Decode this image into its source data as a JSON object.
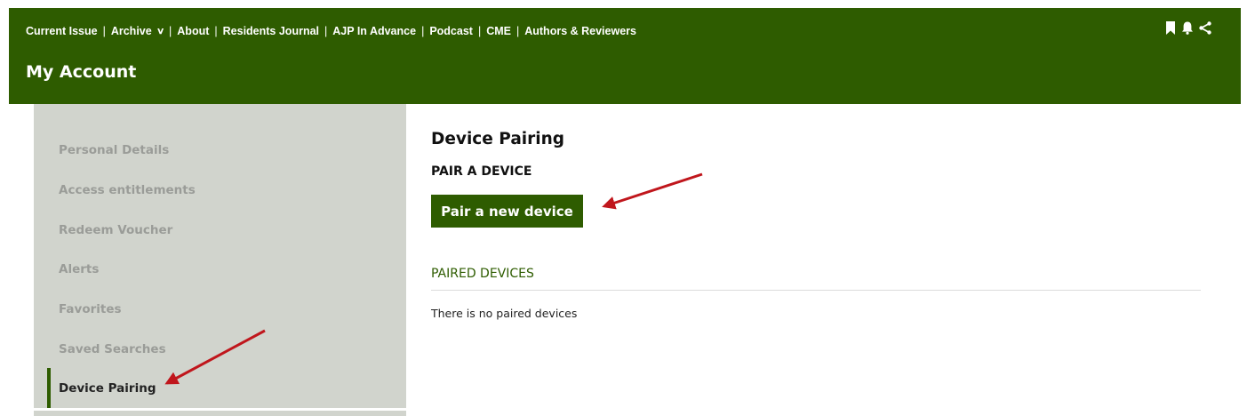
{
  "topnav": {
    "items": [
      "Current Issue",
      "Archive",
      "About",
      "Residents Journal",
      "AJP In Advance",
      "Podcast",
      "CME",
      "Authors & Reviewers"
    ],
    "separator": "|",
    "archive_chevron": "∨"
  },
  "header": {
    "title": "My Account"
  },
  "sidebar": {
    "items": [
      {
        "label": "Personal Details"
      },
      {
        "label": "Access entitlements"
      },
      {
        "label": "Redeem Voucher"
      },
      {
        "label": "Alerts"
      },
      {
        "label": "Favorites"
      },
      {
        "label": "Saved Searches"
      },
      {
        "label": "Device Pairing"
      }
    ],
    "active_item": "Device Pairing"
  },
  "main": {
    "title": "Device Pairing",
    "pair_heading": "PAIR A DEVICE",
    "pair_button": "Pair a new device",
    "paired_heading": "PAIRED DEVICES",
    "no_devices_text": "There is no paired devices"
  },
  "icons": [
    "bookmark-icon",
    "bell-icon",
    "share-icon"
  ],
  "colors": {
    "brand_green": "#2e5c00",
    "sidebar_bg": "#d1d4cd",
    "sidebar_text": "#9a9c98",
    "annotation_arrow": "#c0161c"
  }
}
